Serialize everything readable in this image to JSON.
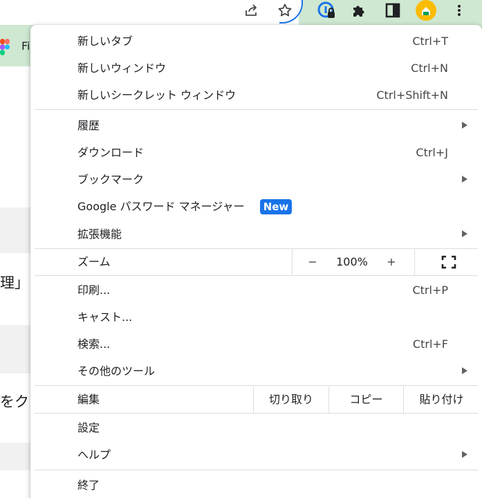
{
  "toolbar": {
    "icons": [
      "share-icon",
      "bookmark-star-icon",
      "password-manager-icon",
      "extensions-icon",
      "side-panel-icon",
      "profile-avatar",
      "more-menu-icon"
    ]
  },
  "tab": {
    "title_fragment": "Fi"
  },
  "page": {
    "fragment_1": "理」",
    "fragment_2": "をク"
  },
  "menu": {
    "new_tab": {
      "label": "新しいタブ",
      "shortcut": "Ctrl+T"
    },
    "new_window": {
      "label": "新しいウィンドウ",
      "shortcut": "Ctrl+N"
    },
    "incognito": {
      "label": "新しいシークレット ウィンドウ",
      "shortcut": "Ctrl+Shift+N"
    },
    "history": {
      "label": "履歴"
    },
    "downloads": {
      "label": "ダウンロード",
      "shortcut": "Ctrl+J"
    },
    "bookmarks": {
      "label": "ブックマーク"
    },
    "password_manager": {
      "label": "Google パスワード マネージャー",
      "badge": "New"
    },
    "extensions": {
      "label": "拡張機能"
    },
    "zoom": {
      "label": "ズーム",
      "minus": "−",
      "level": "100%",
      "plus": "+"
    },
    "print": {
      "label": "印刷...",
      "shortcut": "Ctrl+P"
    },
    "cast": {
      "label": "キャスト..."
    },
    "find": {
      "label": "検索...",
      "shortcut": "Ctrl+F"
    },
    "more_tools": {
      "label": "その他のツール"
    },
    "edit": {
      "label": "編集",
      "cut": "切り取り",
      "copy": "コピー",
      "paste": "貼り付け"
    },
    "settings": {
      "label": "設定"
    },
    "help": {
      "label": "ヘルプ"
    },
    "exit": {
      "label": "終了"
    }
  },
  "colors": {
    "accent": "#1a73e8",
    "toolbar_green": "#cfe8d1",
    "avatar_yellow": "#fbbc04",
    "separator": "#dadce0"
  }
}
